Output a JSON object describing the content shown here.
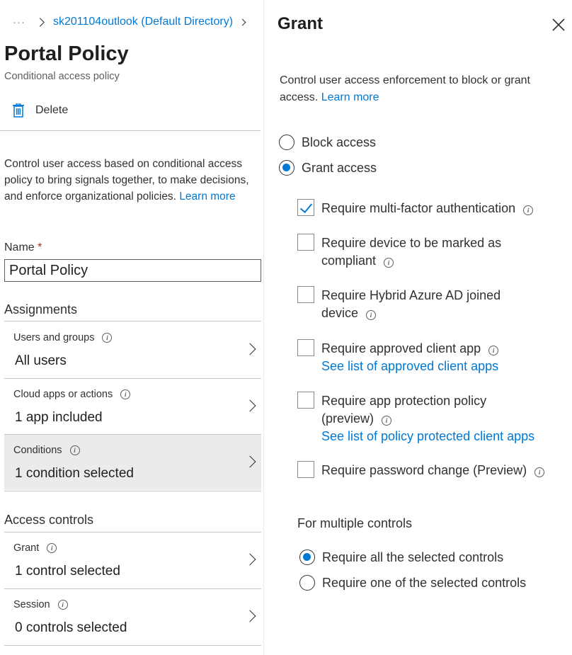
{
  "breadcrumb": {
    "ellipsis": "···",
    "link": "sk201104outlook (Default Directory)"
  },
  "policy": {
    "title": "Portal Policy",
    "subtitle": "Conditional access policy",
    "delete_label": "Delete",
    "description": "Control user access based on conditional access policy to bring signals together, to make decisions, and enforce organizational policies.",
    "learn_more": "Learn more",
    "name_label": "Name",
    "name_required": "*",
    "name_value": "Portal Policy"
  },
  "assignments": {
    "heading": "Assignments",
    "rows": [
      {
        "label": "Users and groups",
        "value": "All users"
      },
      {
        "label": "Cloud apps or actions",
        "value": "1 app included"
      },
      {
        "label": "Conditions",
        "value": "1 condition selected",
        "selected": true
      }
    ]
  },
  "access_controls": {
    "heading": "Access controls",
    "rows": [
      {
        "label": "Grant",
        "value": "1 control selected"
      },
      {
        "label": "Session",
        "value": "0 controls selected"
      }
    ]
  },
  "grant": {
    "title": "Grant",
    "description": "Control user access enforcement to block or grant access.",
    "learn_more": "Learn more",
    "block_label": "Block access",
    "grant_label": "Grant access",
    "access_selected": "grant",
    "controls": [
      {
        "label": "Require multi-factor authentication",
        "checked": true
      },
      {
        "label": "Require device to be marked as compliant",
        "checked": false
      },
      {
        "label": "Require Hybrid Azure AD joined device",
        "checked": false
      },
      {
        "label": "Require approved client app",
        "link": "See list of approved client apps",
        "checked": false
      },
      {
        "label": "Require app protection policy (preview)",
        "link": "See list of policy protected client apps",
        "checked": false
      },
      {
        "label": "Require password change (Preview)",
        "checked": false
      }
    ],
    "multiple_label": "For multiple controls",
    "require_all": "Require all the selected controls",
    "require_one": "Require one of the selected controls",
    "multiple_selected": "all"
  },
  "icons": {
    "delete": "trash-icon",
    "info": "info-icon",
    "chevron": "chevron-right-icon",
    "close": "close-icon"
  },
  "colors": {
    "accent": "#0078d4",
    "selected_row": "#edebe9",
    "required": "#a4262c"
  }
}
